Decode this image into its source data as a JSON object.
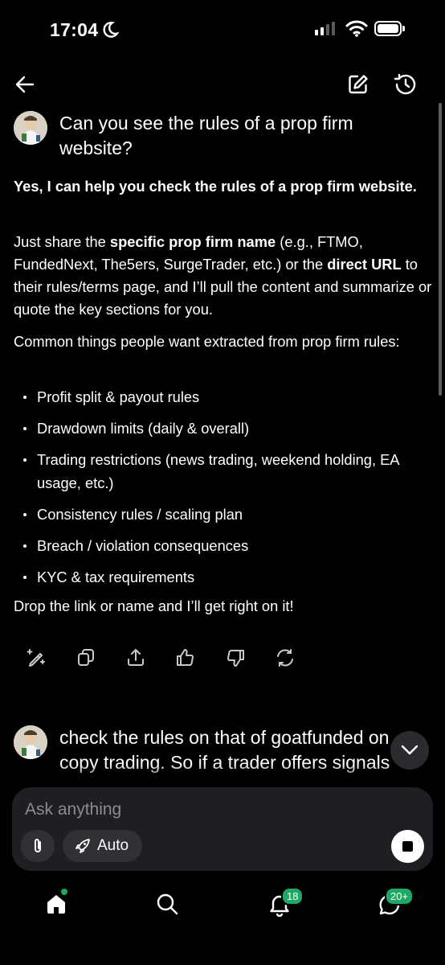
{
  "status": {
    "time": "17:04"
  },
  "conversation": {
    "user_message_1": "Can you see the rules of a prop firm website?",
    "reply": {
      "lead": "Yes, I can help you check the rules of a prop firm website.",
      "p2_a": "Just share the ",
      "p2_b": "specific prop firm name",
      "p2_c": " (e.g., FTMO, FundedNext, The5ers, SurgeTrader, etc.) or the ",
      "p2_d": "direct URL",
      "p2_e": " to their rules/terms page, and I’ll pull the content and summarize or quote the key sections for you.",
      "p3": "Common things people want extracted from prop firm rules:",
      "bullets": [
        "Profit split & payout rules",
        "Drawdown limits (daily & overall)",
        "Trading restrictions (news trading, weekend holding, EA usage, etc.)",
        "Consistency rules / scaling plan",
        "Breach / violation consequences",
        "KYC & tax requirements"
      ],
      "closing": "Drop the link or name and I’ll get right on it!"
    },
    "user_message_2": "check the rules on that of goatfunded on copy trading. So if a trader offers signals"
  },
  "composer": {
    "placeholder": "Ask anything",
    "mode_label": "Auto"
  },
  "tabbar": {
    "notifications_badge": "18",
    "messages_badge": "20+"
  },
  "colors": {
    "background": "#000000",
    "composer": "#1e1f22",
    "accent": "#1ea866"
  },
  "icons": [
    "back-arrow-icon",
    "edit-icon",
    "history-icon",
    "regenerate-edit-icon",
    "copy-icon",
    "share-icon",
    "thumbs-up-icon",
    "thumbs-down-icon",
    "refresh-icon",
    "chevron-down-icon",
    "paperclip-icon",
    "rocket-icon",
    "stop-icon",
    "home-icon",
    "search-icon",
    "bell-icon",
    "chat-icon"
  ]
}
